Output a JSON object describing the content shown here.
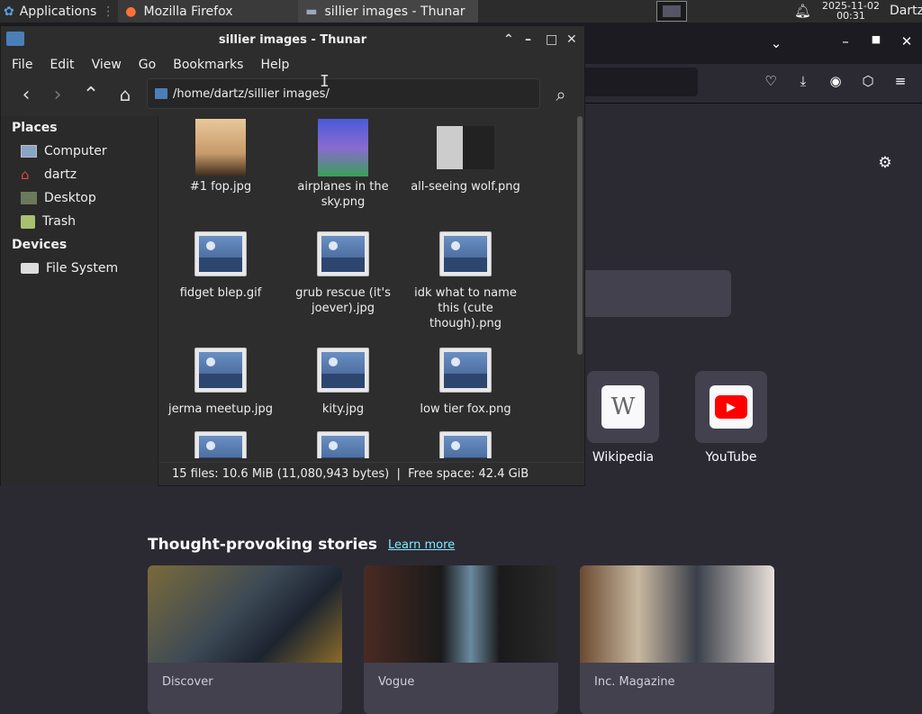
{
  "panel": {
    "applications": "Applications",
    "tasks": [
      {
        "label": "Mozilla Firefox"
      },
      {
        "label": "sillier images - Thunar"
      }
    ],
    "clock_date": "2025-11-02",
    "clock_time": "00:31",
    "user": "Dartz"
  },
  "thunar": {
    "title": "sillier images - Thunar",
    "menu": [
      "File",
      "Edit",
      "View",
      "Go",
      "Bookmarks",
      "Help"
    ],
    "path": "/home/dartz/sillier images/",
    "places_header": "Places",
    "places": [
      "Computer",
      "dartz",
      "Desktop",
      "Trash"
    ],
    "devices_header": "Devices",
    "devices": [
      "File System"
    ],
    "files": [
      "#1 fop.jpg",
      "airplanes in the sky.png",
      "all-seeing wolf.png",
      "fidget blep.gif",
      "grub rescue (it's joever).jpg",
      "idk what to name this (cute though).png",
      "jerma meetup.jpg",
      "kity.jpg",
      "low tier fox.png"
    ],
    "status": "15 files: 10.6 MiB (11,080,943 bytes)  |  Free space: 42.4 GiB"
  },
  "firefox": {
    "shortcuts": [
      {
        "label": "Wikipedia"
      },
      {
        "label": "YouTube"
      }
    ],
    "stories_title": "Thought-provoking stories",
    "learn_more": "Learn more",
    "stories": [
      {
        "source": "Discover"
      },
      {
        "source": "Vogue"
      },
      {
        "source": "Inc. Magazine"
      }
    ]
  }
}
